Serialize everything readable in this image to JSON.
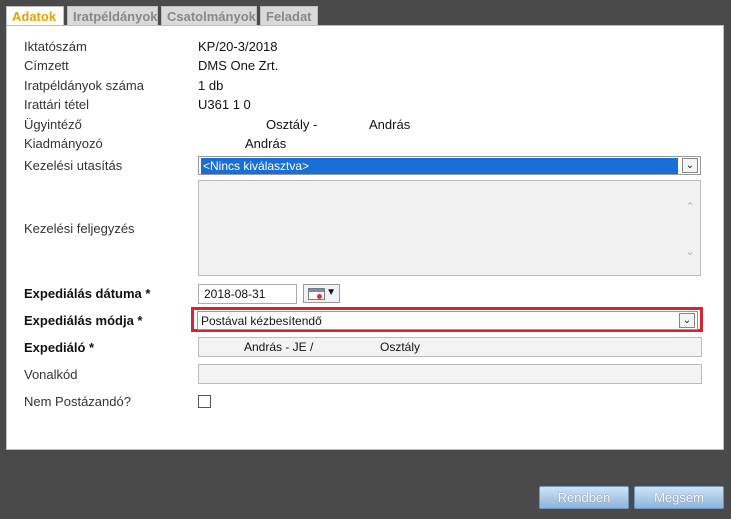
{
  "tabs": [
    {
      "label": "Adatok",
      "active": true
    },
    {
      "label": "Iratpéldányok",
      "active": false
    },
    {
      "label": "Csatolmányok",
      "active": false
    },
    {
      "label": "Feladat",
      "active": false
    }
  ],
  "fields": {
    "iktatoszam": {
      "label": "Iktatószám",
      "value": "KP/20-3/2018"
    },
    "cimzett": {
      "label": "Címzett",
      "value": "DMS One Zrt."
    },
    "iratpeldanyok_szama": {
      "label": "Iratpéldányok száma",
      "value": "1 db"
    },
    "irattari_tetel": {
      "label": "Irattári tétel",
      "value": "U361 1 0"
    },
    "ugyintezo": {
      "label": "Ügyintéző",
      "value_a": "Osztály -",
      "value_b": "András"
    },
    "kiadmanyozo": {
      "label": "Kiadmányozó",
      "value": "András"
    },
    "kezelesi_utasitas": {
      "label": "Kezelési utasítás",
      "value": "<Nincs kiválasztva>"
    },
    "kezelesi_feljegyzes": {
      "label": "Kezelési feljegyzés",
      "value": ""
    },
    "expedialas_datuma": {
      "label": "Expediálás dátuma *",
      "value": "2018-08-31"
    },
    "expedialas_modja": {
      "label": "Expediálás módja *",
      "value": "Postával kézbesítendő"
    },
    "expedialo": {
      "label": "Expediáló *",
      "value_a": "András - JE /",
      "value_b": "Osztály"
    },
    "vonalkod": {
      "label": "Vonalkód",
      "value": ""
    },
    "nem_postazando": {
      "label": "Nem Postázandó?",
      "checked": false
    }
  },
  "buttons": {
    "ok": "Rendben",
    "cancel": "Mégsem"
  },
  "colors": {
    "active_tab": "#e3a300",
    "highlight_border": "#d8242c",
    "selection": "#1a6fd6"
  }
}
